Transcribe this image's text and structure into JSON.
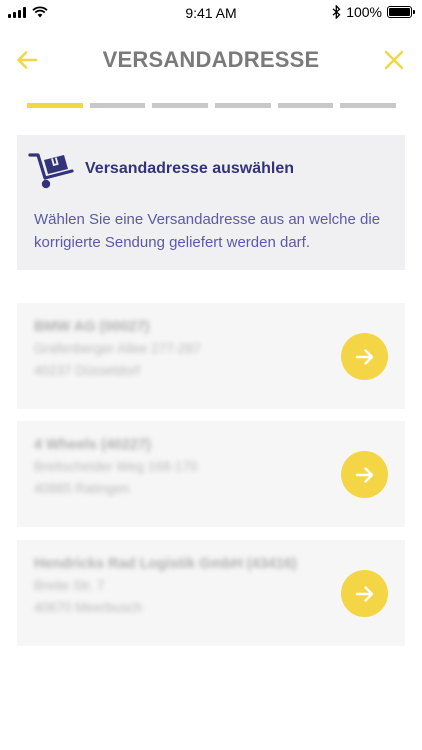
{
  "status_bar": {
    "time": "9:41 AM",
    "battery_percent": "100%",
    "battery_level": 1.0
  },
  "header": {
    "title": "VERSANDADRESSE",
    "back_icon": "arrow-left-icon",
    "close_icon": "close-icon"
  },
  "progress": {
    "total_steps": 6,
    "current_step": 1
  },
  "colors": {
    "accent": "#f4d545",
    "title_gray": "#7a7a7a",
    "info_title": "#33337a",
    "info_text": "#5a5aa8",
    "card_bg": "#f0f0f2"
  },
  "info": {
    "icon": "hand-truck-package-icon",
    "title": "Versandadresse auswählen",
    "text": "Wählen Sie eine Versandadresse aus an welche die korrigierte Sendung geliefert werden darf."
  },
  "addresses": [
    {
      "name": "BMW AG (00027)",
      "street": "Grafenberger Allee 277-287",
      "city": "40237 Düsseldorf"
    },
    {
      "name": "4 Wheels (40227)",
      "street": "Breitscheider Weg 168-170",
      "city": "40885 Ratingen"
    },
    {
      "name": "Hendricks Rad Logistik GmbH (43416)",
      "street": "Breite Str. 7",
      "city": "40670 Meerbusch"
    }
  ]
}
